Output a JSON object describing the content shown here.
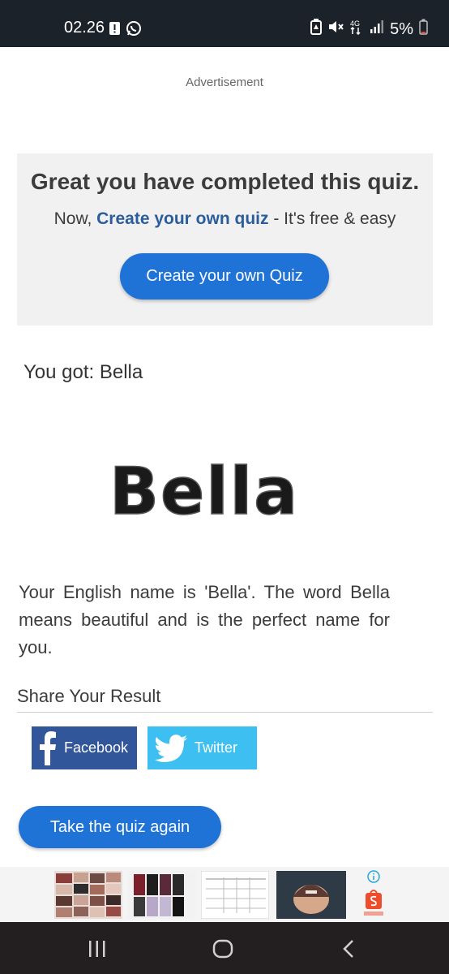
{
  "status_bar": {
    "time": "02.26",
    "battery": "5%",
    "network": "4G",
    "icons": [
      "alert-icon",
      "whatsapp-icon",
      "battery-saver-icon",
      "mute-icon",
      "data-4g-icon",
      "signal-icon",
      "battery-icon"
    ]
  },
  "ad": {
    "label": "Advertisement"
  },
  "cta": {
    "heading": "Great you have completed this quiz.",
    "sub_prefix": "Now,",
    "sub_link": "Create your own quiz",
    "sub_suffix": "- It's free & easy",
    "button_label": "Create your own Quiz"
  },
  "result": {
    "label": "You got: Bella",
    "image_text": "Bella",
    "description": "Your English name is 'Bella'. The word Bella means beautiful and is the perfect name for you."
  },
  "share": {
    "title": "Share Your Result",
    "facebook_label": "Facebook",
    "twitter_label": "Twitter"
  },
  "retake": {
    "label": "Take the quiz again"
  },
  "ad_strip": {
    "thumbnails": [
      "clothing-pile-thumbnail",
      "clothing-stack-thumbnail",
      "size-chart-thumbnail",
      "cap-thumbnail"
    ],
    "icons": [
      "info-icon",
      "shopee-icon"
    ]
  },
  "nav_bar": {
    "icons": [
      "recent-apps-icon",
      "home-icon",
      "back-icon"
    ]
  },
  "colors": {
    "accent": "#1f72d6",
    "link": "#2b5d9c",
    "facebook": "#31579a",
    "twitter": "#3dbff2",
    "status_bar": "#1b222a"
  }
}
